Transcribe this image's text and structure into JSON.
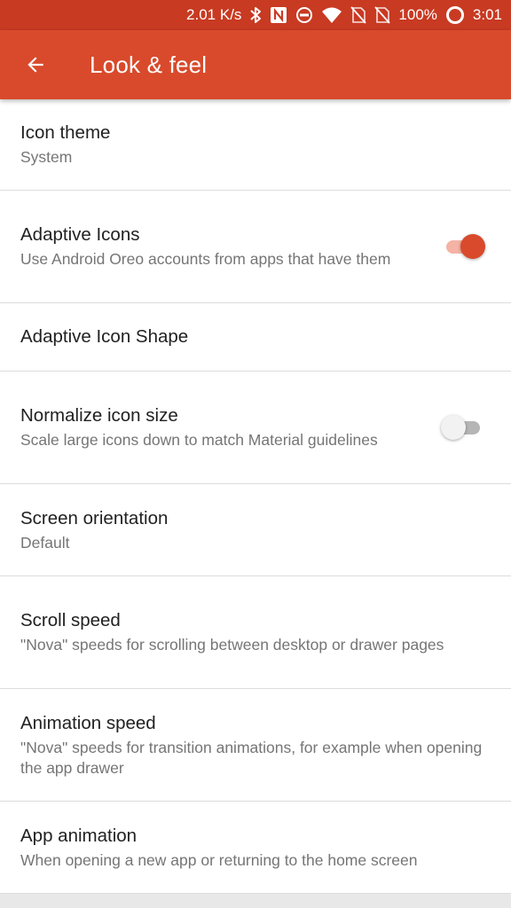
{
  "status_bar": {
    "network_speed": "2.01 K/s",
    "battery": "100%",
    "time": "3:01",
    "icons": [
      "bluetooth-icon",
      "nfc-icon",
      "do-not-disturb-icon",
      "wifi-icon",
      "no-sim-icon",
      "no-sim-icon",
      "battery-icon"
    ]
  },
  "app_bar": {
    "title": "Look & feel",
    "back_icon": "arrow-back-icon"
  },
  "colors": {
    "accent": "#d84a2b",
    "status_bar": "#c83a22",
    "switch_on_track": "#f4b3a5",
    "title_text": "#212121",
    "summary_text": "#757575"
  },
  "settings": [
    {
      "title": "Icon theme",
      "summary": "System"
    },
    {
      "title": "Adaptive Icons",
      "summary": "Use Android Oreo accounts from apps that have them",
      "toggle": true
    },
    {
      "title": "Adaptive Icon Shape"
    },
    {
      "title": "Normalize icon size",
      "summary": "Scale large icons down to match Material guidelines",
      "toggle": false
    },
    {
      "title": "Screen orientation",
      "summary": "Default"
    },
    {
      "title": "Scroll speed",
      "summary": "\"Nova\" speeds for scrolling between desktop or drawer pages"
    },
    {
      "title": "Animation speed",
      "summary": "\"Nova\" speeds for transition animations, for example when opening the app drawer"
    },
    {
      "title": "App animation",
      "summary": "When opening a new app or returning to the home screen"
    }
  ]
}
